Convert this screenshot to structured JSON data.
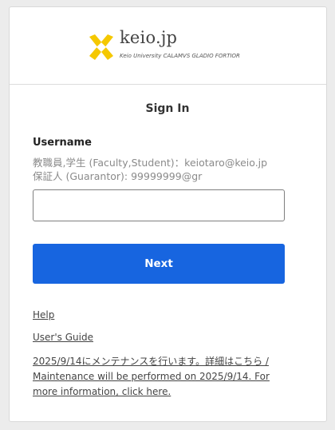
{
  "header": {
    "logo_text": "keio.jp",
    "tagline": "Keio University CALAMVS GLADIO FORTIOR",
    "logo_icon": "crossed-pens-logo",
    "logo_color": "#f5c800"
  },
  "form": {
    "title": "Sign In",
    "username_label": "Username",
    "hint_line1": "教職員,学生 (Faculty,Student)：keiotaro@keio.jp",
    "hint_line2": "保証人 (Guarantor): 99999999@gr",
    "username_value": "",
    "next_label": "Next",
    "button_color": "#1765e0"
  },
  "links": {
    "help": "Help",
    "users_guide": "User's Guide",
    "maintenance": "2025/9/14にメンテナンスを行います。詳細はこちら / Maintenance will be performed on 2025/9/14. For more information, click here."
  }
}
